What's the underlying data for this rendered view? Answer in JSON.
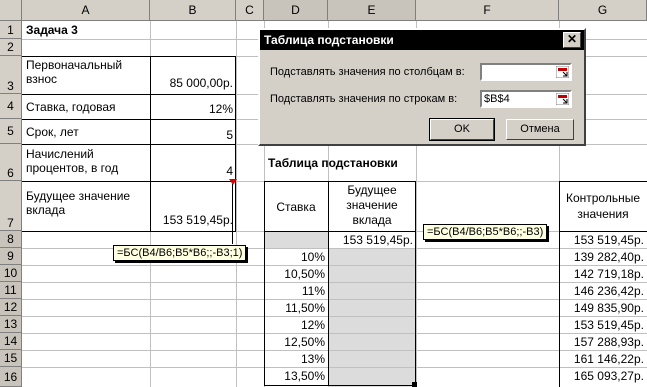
{
  "columns": [
    "A",
    "B",
    "C",
    "D",
    "E",
    "F",
    "G"
  ],
  "rows": [
    "1",
    "2",
    "3",
    "4",
    "5",
    "6",
    "7",
    "8",
    "9",
    "10",
    "11",
    "12",
    "13",
    "14",
    "15",
    "16"
  ],
  "task_title": "Задача 3",
  "params": [
    {
      "label_lines": [
        "Первоначальный",
        "взнос"
      ],
      "value": "85 000,00р."
    },
    {
      "label_lines": [
        "Ставка, годовая"
      ],
      "value": "12%"
    },
    {
      "label_lines": [
        "Срок, лет"
      ],
      "value": "5"
    },
    {
      "label_lines": [
        "Начислений",
        "процентов, в год"
      ],
      "value": "4"
    },
    {
      "label_lines": [
        "Будущее значение",
        "вклада"
      ],
      "value": "153 519,45р."
    }
  ],
  "table_title": "Таблица подстановки",
  "table_headers": {
    "rate": "Ставка",
    "future_lines": [
      "Будущее",
      "значение",
      "вклада"
    ],
    "control_lines": [
      "Контрольные",
      "значения"
    ]
  },
  "table_top_value": "153 519,45р.",
  "rates": [
    "10%",
    "10,50%",
    "11%",
    "11,50%",
    "12%",
    "12,50%",
    "13%",
    "13,50%"
  ],
  "control_values": [
    "153 519,45р.",
    "139 282,40р.",
    "142 719,18р.",
    "146 236,42р.",
    "149 835,90р.",
    "153 519,45р.",
    "157 288,93р.",
    "161 146,22р.",
    "165 093,27р."
  ],
  "tooltips": {
    "b7_formula": "=БС(B4/B6;B5*B6;;-B3;1)",
    "e8_formula": "=БС(B4/B6;B5*B6;;-B3)"
  },
  "dialog": {
    "title": "Таблица подстановки",
    "close": "✕",
    "col_label": "Подставлять значения по столбцам в:",
    "row_label": "Подставлять значения по строкам в:",
    "col_value": "",
    "row_value": "$B$4",
    "ok": "OK",
    "cancel": "Отмена"
  }
}
